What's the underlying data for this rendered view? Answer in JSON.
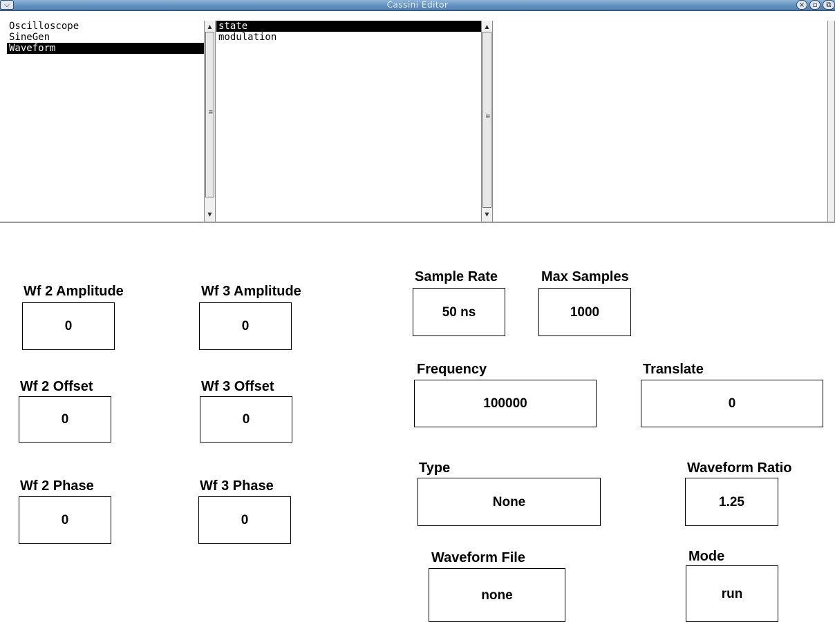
{
  "window": {
    "title": "Cassini Editor",
    "menu_glyph": "⌵",
    "close_glyph": "×",
    "minimize_glyph": "▫",
    "maximize_glyph": "⧉"
  },
  "lists": {
    "components": [
      "Oscilloscope",
      "SineGen",
      "Waveform"
    ],
    "components_selected": "Waveform",
    "properties": [
      "state",
      "modulation"
    ],
    "properties_selected": "state"
  },
  "fields": {
    "wf2_amplitude": {
      "label": "Wf 2 Amplitude",
      "value": "0"
    },
    "wf3_amplitude": {
      "label": "Wf 3 Amplitude",
      "value": "0"
    },
    "wf2_offset": {
      "label": "Wf 2 Offset",
      "value": "0"
    },
    "wf3_offset": {
      "label": "Wf 3 Offset",
      "value": "0"
    },
    "wf2_phase": {
      "label": "Wf 2 Phase",
      "value": "0"
    },
    "wf3_phase": {
      "label": "Wf 3 Phase",
      "value": "0"
    },
    "sample_rate": {
      "label": "Sample Rate",
      "value": "50 ns"
    },
    "max_samples": {
      "label": "Max Samples",
      "value": "1000"
    },
    "frequency": {
      "label": "Frequency",
      "value": "100000"
    },
    "translate": {
      "label": "Translate",
      "value": "0"
    },
    "type": {
      "label": "Type",
      "value": "None"
    },
    "waveform_ratio": {
      "label": "Waveform Ratio",
      "value": "1.25"
    },
    "waveform_file": {
      "label": "Waveform File",
      "value": "none"
    },
    "mode": {
      "label": "Mode",
      "value": "run"
    }
  },
  "colors": {
    "titlebar": "#5f8fbf",
    "selection_bg": "#000000",
    "selection_fg": "#ffffff"
  }
}
